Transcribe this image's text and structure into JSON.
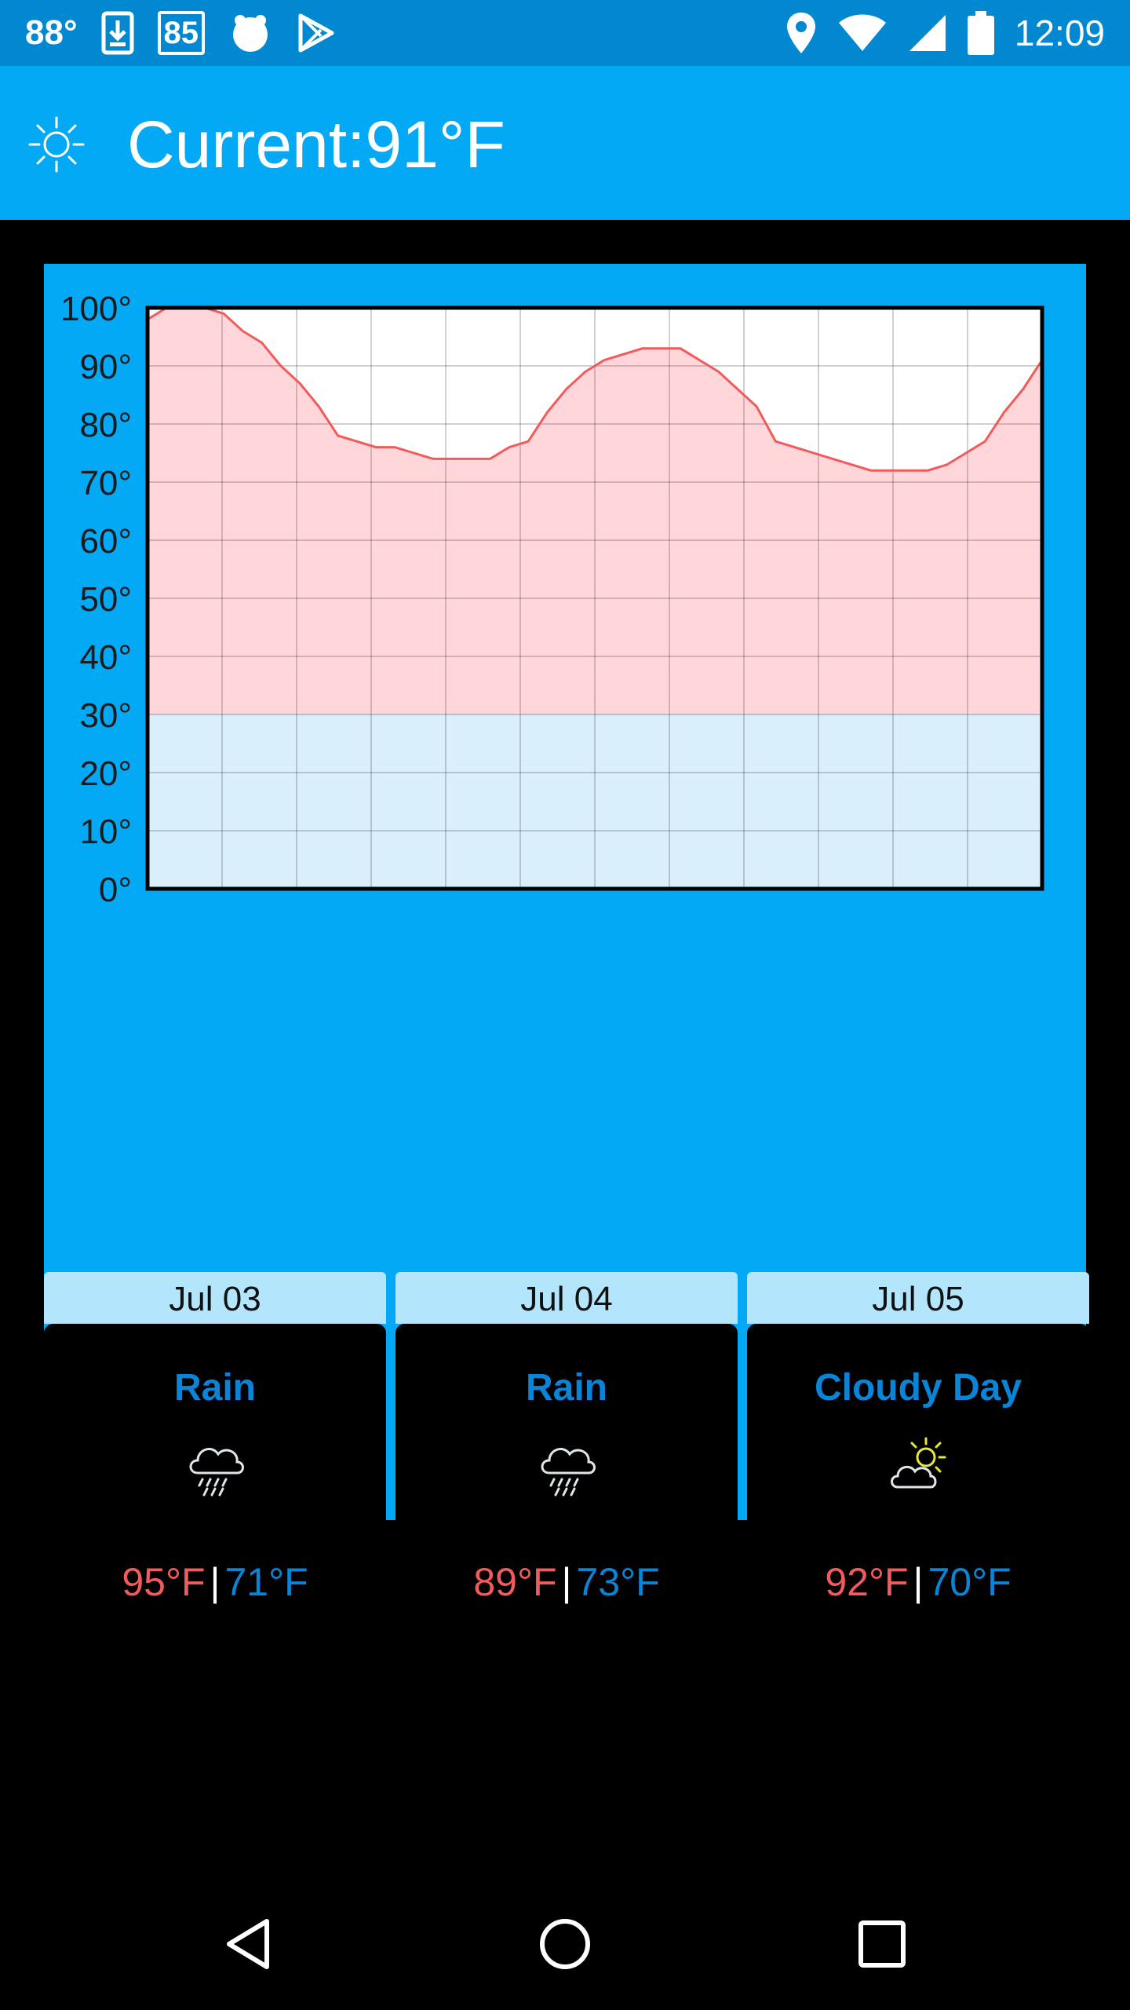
{
  "status_bar": {
    "temperature": "88°",
    "badge_number": "85",
    "time": "12:09",
    "left_icons": [
      "download-icon",
      "calendar-badge-icon",
      "android-icon",
      "play-store-icon"
    ],
    "right_icons": [
      "location-icon",
      "wifi-icon",
      "signal-icon",
      "battery-icon"
    ]
  },
  "app_bar": {
    "icon": "sun-icon",
    "title": "Current:91°F"
  },
  "colors": {
    "status_bar": "#0288d1",
    "app_bar": "#03a9f4",
    "panel": "#03a9f4",
    "high_temp": "#f15b5b",
    "low_temp": "#0a84d6",
    "chart_fill_warm": "#ffd6d9",
    "chart_fill_cold": "#d9effc"
  },
  "chart_data": {
    "type": "area",
    "ylim": [
      0,
      100
    ],
    "y_tick_labels": [
      "100°",
      "90°",
      "80°",
      "70°",
      "60°",
      "50°",
      "40°",
      "30°",
      "20°",
      "10°",
      "0°"
    ],
    "freezing_band_top": 30,
    "grid": true,
    "x": [
      0,
      1,
      2,
      3,
      4,
      5,
      6,
      7,
      8,
      9,
      10,
      11,
      12,
      13,
      14,
      15,
      16,
      17,
      18,
      19,
      20,
      21,
      22,
      23,
      24,
      25,
      26,
      27,
      28,
      29,
      30,
      31,
      32,
      33,
      34,
      35,
      36,
      37,
      38,
      39,
      40,
      41,
      42,
      43,
      44,
      45,
      46,
      47
    ],
    "values": [
      98,
      100,
      100,
      100,
      99,
      96,
      94,
      90,
      87,
      83,
      78,
      77,
      76,
      76,
      75,
      74,
      74,
      74,
      74,
      76,
      77,
      82,
      86,
      89,
      91,
      92,
      93,
      93,
      93,
      91,
      89,
      86,
      83,
      77,
      76,
      75,
      74,
      73,
      72,
      72,
      72,
      72,
      73,
      75,
      77,
      82,
      86,
      91
    ]
  },
  "forecast": [
    {
      "date": "Jul 03",
      "condition": "Rain",
      "icon": "rain-cloud-icon",
      "high": "95°F",
      "low": "71°F"
    },
    {
      "date": "Jul 04",
      "condition": "Rain",
      "icon": "rain-cloud-icon",
      "high": "89°F",
      "low": "73°F"
    },
    {
      "date": "Jul 05",
      "condition": "Cloudy Day",
      "icon": "cloudy-day-icon",
      "high": "92°F",
      "low": "70°F"
    }
  ],
  "temp_separator": "|",
  "nav_bar": {
    "back": "back-icon",
    "home": "home-icon",
    "recents": "recents-icon"
  }
}
